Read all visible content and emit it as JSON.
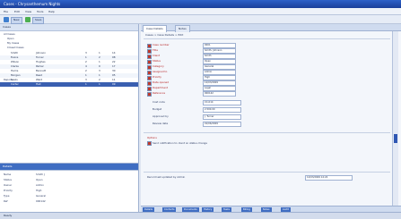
{
  "window": {
    "title": "Cases - Chrysanthemum Nights"
  },
  "menu": [
    "File",
    "Edit",
    "View",
    "Tools",
    "Help"
  ],
  "toolbar": {
    "new_label": "New",
    "save_label": "Save"
  },
  "left": {
    "header": "Cases",
    "tree": [
      "All Cases",
      "Open",
      "My Cases",
      "Closed Cases",
      "Reports",
      "Archive"
    ],
    "rows": [
      {
        "c1": "Smith",
        "c2": "Johnson",
        "c3": "3",
        "c4": "1",
        "c5": "14"
      },
      {
        "c1": "Evans",
        "c2": "Turner",
        "c3": "1",
        "c4": "2",
        "c5": "08"
      },
      {
        "c1": "Wilson",
        "c2": "Hughes",
        "c3": "2",
        "c4": "1",
        "c5": "22"
      },
      {
        "c1": "Clarke",
        "c2": "Parker",
        "c3": "4",
        "c4": "0",
        "c5": "17"
      },
      {
        "c1": "Harris",
        "c2": "Bennett",
        "c3": "2",
        "c4": "3",
        "c5": "30"
      },
      {
        "c1": "Morgan",
        "c2": "Reed",
        "c3": "1",
        "c4": "1",
        "c5": "05"
      },
      {
        "c1": "Lewis",
        "c2": "Ward",
        "c3": "3",
        "c4": "2",
        "c5": "11"
      },
      {
        "c1": "Carter",
        "c2": "Hall",
        "c3": "1",
        "c4": "1",
        "c5": "09"
      }
    ],
    "selected_index": 7
  },
  "left2": {
    "header": "Details",
    "items": [
      {
        "k": "Name",
        "v": "Smith J"
      },
      {
        "k": "Status",
        "v": "Open"
      },
      {
        "k": "Owner",
        "v": "Admin"
      },
      {
        "k": "Priority",
        "v": "High"
      },
      {
        "k": "Type",
        "v": "General"
      },
      {
        "k": "Ref",
        "v": "000142"
      }
    ]
  },
  "tabs": [
    "Case Details",
    "Notes"
  ],
  "breadcrumb": "Cases > Case Details > Edit",
  "form": {
    "fields": [
      {
        "label": "Case number",
        "value": "0001",
        "req": true
      },
      {
        "label": "Title",
        "value": "Smith, Johnson",
        "req": true
      },
      {
        "label": "Client",
        "value": "Smith",
        "req": true
      },
      {
        "label": "Status",
        "value": "Open",
        "req": true
      },
      {
        "label": "Category",
        "value": "General",
        "req": true
      },
      {
        "label": "Assigned to",
        "value": "Admin",
        "req": true
      },
      {
        "label": "Priority",
        "value": "High",
        "req": true
      },
      {
        "label": "Date opened",
        "value": "12/03/2009",
        "req": true
      },
      {
        "label": "Department",
        "value": "Legal",
        "req": true
      },
      {
        "label": "Reference",
        "value": "000142",
        "req": true
      }
    ],
    "extra": [
      {
        "label": "Cost code",
        "value": "CC-014"
      },
      {
        "label": "Budget",
        "value": "2,500.00"
      },
      {
        "label": "Approved by",
        "value": "J. Turner"
      },
      {
        "label": "Review date",
        "value": "01/06/2009"
      }
    ],
    "section_label": "Options",
    "option_text": "Send notification to client on status change",
    "footer_text": "Record last updated by Admin",
    "footer_value": "12/03/2009 14:22"
  },
  "bottom_tabs": [
    "Details",
    "Contacts",
    "Documents",
    "History",
    "Tasks",
    "Billing",
    "Notes",
    "Audit"
  ],
  "status": {
    "text": "Ready"
  }
}
